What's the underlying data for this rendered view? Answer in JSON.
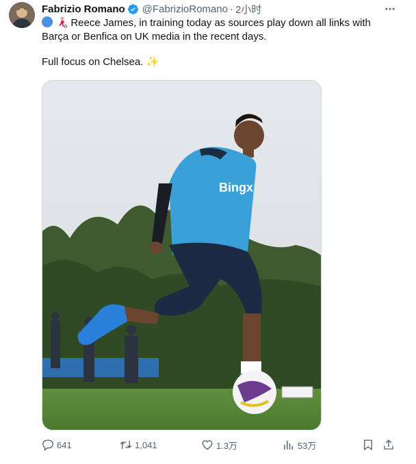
{
  "tweet": {
    "author_name": "Fabrizio Romano",
    "handle": "@FabrizioRomano",
    "separator": "·",
    "time": "2小时",
    "text_lines": [
      "Reece James, in training today as sources play down all links with",
      "Barça or Benfica on UK media in the recent days.",
      "Full focus on Chelsea. ✨"
    ],
    "leading_emojis": [
      "blue-circle",
      "football-player"
    ],
    "image": {
      "subject": "player kicking a ball on a training pitch",
      "shirt_text": "Bingx"
    }
  },
  "actions": {
    "replies": "641",
    "reposts": "1,041",
    "likes": "1.3万",
    "views": "53万"
  },
  "icons": [
    "verified-badge-icon",
    "more-icon",
    "reply-icon",
    "repost-icon",
    "like-icon",
    "views-icon",
    "bookmark-icon",
    "share-icon"
  ],
  "colors": {
    "accent": "#1d9bf0",
    "secondary_text": "#536471",
    "text": "#0f1419"
  }
}
